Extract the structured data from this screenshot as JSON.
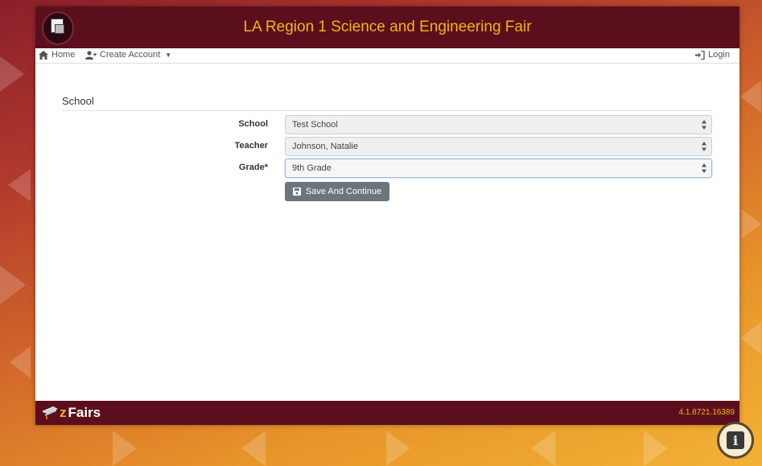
{
  "header": {
    "title": "LA Region 1 Science and Engineering Fair",
    "logo_icon": "fair-logo-icon"
  },
  "nav": {
    "home": "Home",
    "create_account": "Create Account",
    "login": "Login"
  },
  "section": {
    "title": "School"
  },
  "form": {
    "school": {
      "label": "School",
      "value": "Test School"
    },
    "teacher": {
      "label": "Teacher",
      "value": "Johnson, Natalie"
    },
    "grade": {
      "label": "Grade*",
      "value": "9th Grade"
    },
    "save_button": "Save And Continue"
  },
  "footer": {
    "brand_prefix": "z",
    "brand_rest": "Fairs",
    "version": "4.1.8721.16389"
  },
  "colors": {
    "maroon": "#5b0f1c",
    "gold": "#f5b21b",
    "button_gray": "#6c757d"
  }
}
